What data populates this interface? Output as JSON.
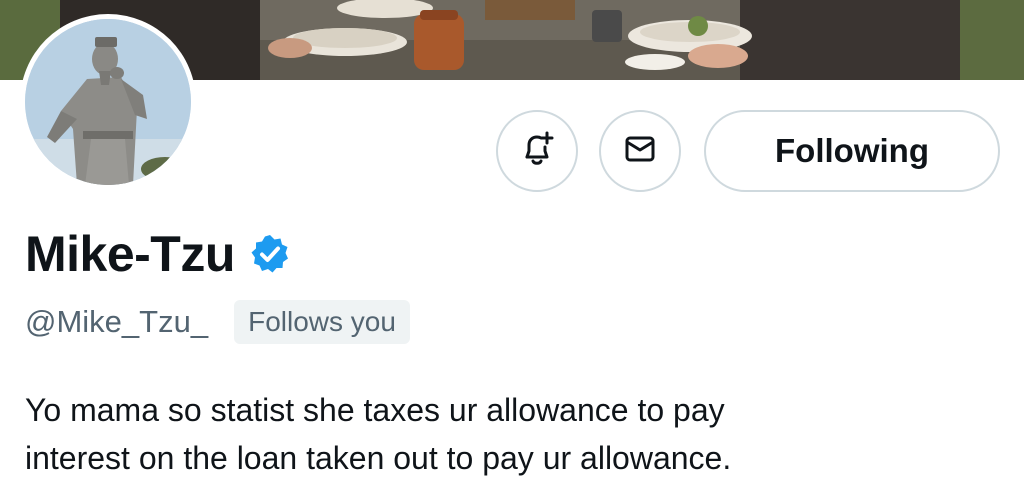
{
  "profile": {
    "display_name": "Mike-Tzu",
    "handle": "@Mike_Tzu_",
    "follows_you_badge": "Follows you",
    "verified": true,
    "bio_lines": [
      "Yo mama so statist she taxes ur allowance to pay",
      "interest on the loan taken out to pay ur allowance."
    ]
  },
  "actions": {
    "notify_icon": "bell-plus-icon",
    "message_icon": "envelope-icon",
    "following_label": "Following"
  },
  "colors": {
    "text_primary": "#0f1419",
    "text_secondary": "#536471",
    "border": "#cfd9de",
    "verified_blue": "#1d9bf0",
    "badge_bg": "#eff3f4"
  }
}
